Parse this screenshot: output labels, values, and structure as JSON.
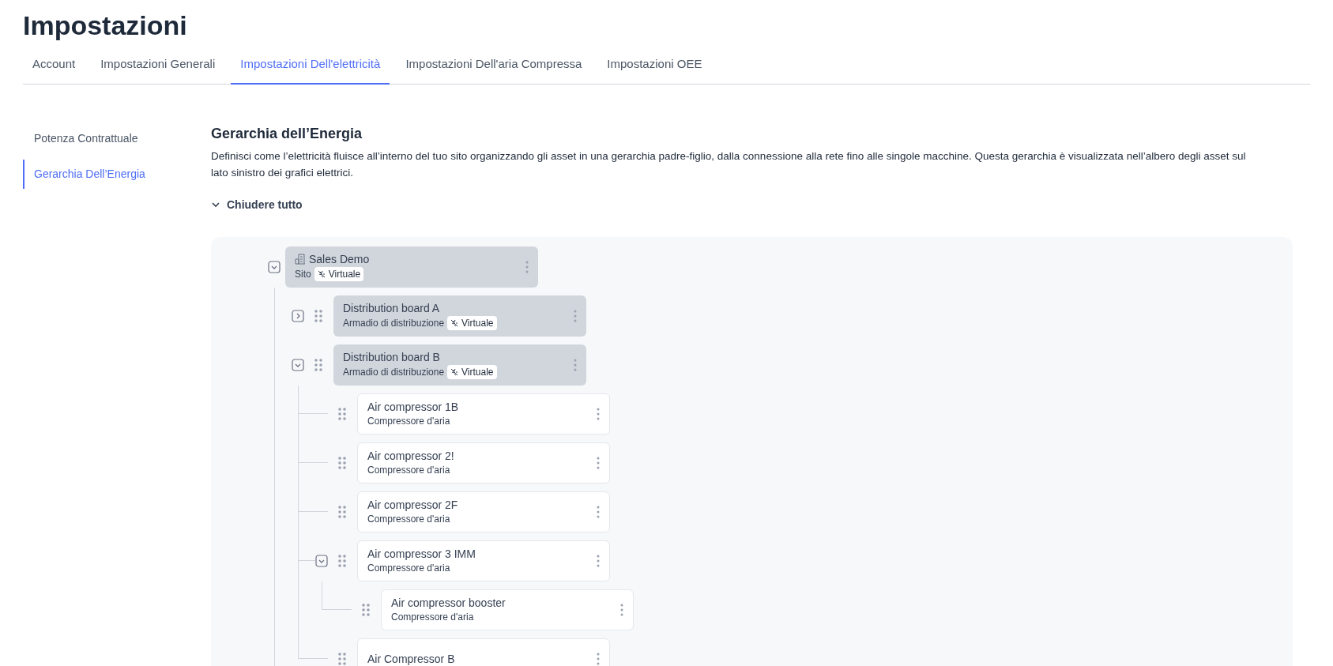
{
  "page": {
    "title": "Impostazioni"
  },
  "tabs": [
    {
      "label": "Account",
      "selected": false
    },
    {
      "label": "Impostazioni Generali",
      "selected": false
    },
    {
      "label": "Impostazioni Dell'elettricità",
      "selected": true
    },
    {
      "label": "Impostazioni Dell'aria Compressa",
      "selected": false
    },
    {
      "label": "Impostazioni OEE",
      "selected": false
    }
  ],
  "sidebar": {
    "items": [
      {
        "label": "Potenza Contrattuale",
        "selected": false
      },
      {
        "label": "Gerarchia Dell’Energia",
        "selected": true
      }
    ]
  },
  "section": {
    "title": "Gerarchia dell’Energia",
    "description": "Definisci come l’elettricità fluisce all’interno del tuo sito organizzando gli asset in una gerarchia padre-figlio, dalla connessione alla rete fino alle singole macchine. Questa gerarchia è visualizzata nell’albero degli asset sul lato sinistro dei grafici elettrici.",
    "collapse_all": "Chiudere tutto"
  },
  "tree": [
    {
      "title": "Sales Demo",
      "subtitle": "Sito",
      "kind": "site",
      "badge": "Virtuale",
      "expanded": true,
      "children": [
        {
          "title": "Distribution board A",
          "subtitle": "Armadio di distribuzione",
          "kind": "board",
          "badge": "Virtuale",
          "expanded": false
        },
        {
          "title": "Distribution board B",
          "subtitle": "Armadio di distribuzione",
          "kind": "board",
          "badge": "Virtuale",
          "expanded": true,
          "children": [
            {
              "title": "Air compressor 1B",
              "subtitle": "Compressore d'aria",
              "kind": "asset"
            },
            {
              "title": "Air compressor 2!",
              "subtitle": "Compressore d'aria",
              "kind": "asset"
            },
            {
              "title": "Air compressor 2F",
              "subtitle": "Compressore d'aria",
              "kind": "asset"
            },
            {
              "title": "Air compressor 3 IMM",
              "subtitle": "Compressore d'aria",
              "kind": "asset",
              "expanded": true,
              "children": [
                {
                  "title": "Air compressor booster",
                  "subtitle": "Compressore d'aria",
                  "kind": "asset"
                }
              ]
            },
            {
              "title": "Air Compressor B",
              "kind": "asset"
            }
          ]
        }
      ]
    }
  ]
}
